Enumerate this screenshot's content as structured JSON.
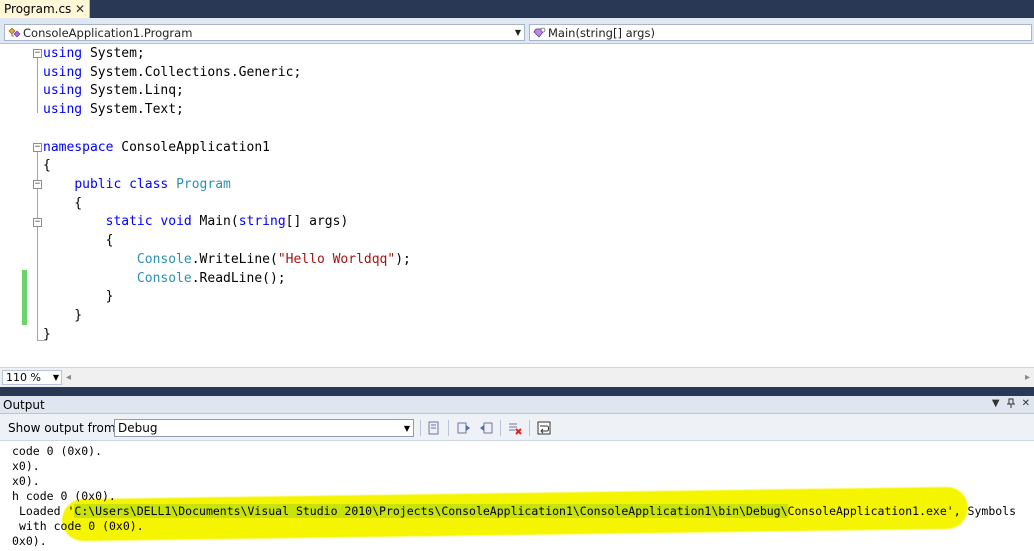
{
  "tab": {
    "label": "Program.cs",
    "close": "✕"
  },
  "navbar": {
    "class_combo": "ConsoleApplication1.Program",
    "member_combo": "Main(string[] args)"
  },
  "code": {
    "l1_kw": "using",
    "l1_rest": " System;",
    "l2_kw": "using",
    "l2_rest": " System.Collections.Generic;",
    "l3_kw": "using",
    "l3_rest": " System.Linq;",
    "l4_kw": "using",
    "l4_rest": " System.Text;",
    "l6_kw": "namespace",
    "l6_rest": " ConsoleApplication1",
    "l7": "{",
    "l8_indent": "    ",
    "l8_kw": "public class",
    "l8_type": "Program",
    "l9": "    {",
    "l10_indent": "        ",
    "l10_kw": "static void",
    "l10_rest": " Main(",
    "l10_kw2": "string",
    "l10_rest2": "[] args)",
    "l11": "        {",
    "l12_indent": "            ",
    "l12_type": "Console",
    "l12_rest": ".WriteLine(",
    "l12_str": "\"Hello Worldqq\"",
    "l12_end": ");",
    "l13_indent": "            ",
    "l13_type": "Console",
    "l13_rest": ".ReadLine();",
    "l14": "        }",
    "l15": "    }",
    "l16": "}"
  },
  "zoom": {
    "value": "110 %"
  },
  "output": {
    "title": "Output",
    "show_label": "Show output from:",
    "source": "Debug",
    "lines": {
      "o1": "code 0 (0x0).",
      "o2": "x0).",
      "o3": "x0).",
      "o4": "h code 0 (0x0).",
      "o5_pre": "Loaded '",
      "o5_path": "C:\\Users\\DELL1\\Documents\\Visual Studio 2010\\Projects\\ConsoleApplication1\\ConsoleApplication1\\bin\\Debug\\",
      "o5_file": "ConsoleApplication1.exe",
      "o5_post": "', Symbols",
      "o6": "with code 0 (0x0).",
      "o7": "0x0)."
    }
  },
  "colors": {
    "keyword": "#0000ff",
    "type": "#2b91af",
    "string": "#a31515",
    "highlight": "#f5f500"
  }
}
